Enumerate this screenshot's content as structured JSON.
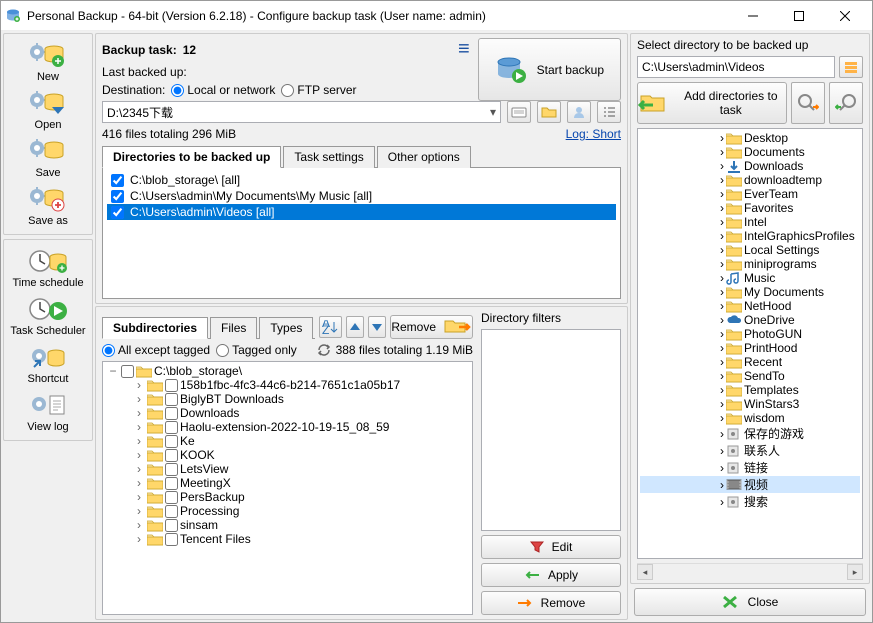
{
  "title": "Personal Backup - 64-bit (Version 6.2.18) - Configure backup task (User name: admin)",
  "sidebar": {
    "g1": [
      {
        "name": "new",
        "label": "New",
        "badge": "plus"
      },
      {
        "name": "open",
        "label": "Open",
        "badge": "down"
      },
      {
        "name": "save",
        "label": "Save",
        "badge": null
      },
      {
        "name": "saveas",
        "label": "Save as",
        "badge": "plus-red"
      }
    ],
    "g2": [
      {
        "name": "timeschedule",
        "label": "Time schedule"
      },
      {
        "name": "taskscheduler",
        "label": "Task Scheduler"
      },
      {
        "name": "shortcut",
        "label": "Shortcut"
      },
      {
        "name": "viewlog",
        "label": "View log"
      }
    ]
  },
  "task": {
    "title_label": "Backup task:",
    "title_value": "12",
    "last_label": "Last backed up:",
    "dest_label": "Destination:",
    "radio_local": "Local or network",
    "radio_ftp": "FTP server",
    "dest_path": "D:\\2345下载",
    "stats": "416 files totaling 296 MiB",
    "log_link": "Log: Short",
    "start_label": "Start backup"
  },
  "tabs": {
    "t1": "Directories to be backed up",
    "t2": "Task settings",
    "t3": "Other options"
  },
  "dirs": [
    {
      "path": "C:\\blob_storage\\ [all]",
      "sel": false
    },
    {
      "path": "C:\\Users\\admin\\My Documents\\My Music [all]",
      "sel": false
    },
    {
      "path": "C:\\Users\\admin\\Videos [all]",
      "sel": true
    }
  ],
  "midbar": {
    "remove": "Remove"
  },
  "subtabs": {
    "t1": "Subdirectories",
    "t2": "Files",
    "t3": "Types"
  },
  "subopts": {
    "all_except": "All except tagged",
    "tagged_only": "Tagged only",
    "stats": "388 files totaling 1.19 MiB"
  },
  "subtree": {
    "root": "C:\\blob_storage\\",
    "items": [
      "158b1fbc-4fc3-44c6-b214-7651c1a05b17",
      "BiglyBT Downloads",
      "Downloads",
      "Haolu-extension-2022-10-19-15_08_59",
      "Ke",
      "KOOK",
      "LetsView",
      "MeetingX",
      "PersBackup",
      "Processing",
      "sinsam",
      "Tencent Files"
    ]
  },
  "filter": {
    "title": "Directory filters",
    "edit": "Edit",
    "apply": "Apply",
    "remove": "Remove"
  },
  "right": {
    "title": "Select directory to be backed up",
    "path": "C:\\Users\\admin\\Videos",
    "add_label": "Add directories to task",
    "items": [
      {
        "name": "Desktop",
        "icon": "folder"
      },
      {
        "name": "Documents",
        "icon": "folder"
      },
      {
        "name": "Downloads",
        "icon": "download"
      },
      {
        "name": "downloadtemp",
        "icon": "folder"
      },
      {
        "name": "EverTeam",
        "icon": "folder"
      },
      {
        "name": "Favorites",
        "icon": "folder"
      },
      {
        "name": "Intel",
        "icon": "folder"
      },
      {
        "name": "IntelGraphicsProfiles",
        "icon": "folder"
      },
      {
        "name": "Local Settings",
        "icon": "folder"
      },
      {
        "name": "miniprograms",
        "icon": "folder"
      },
      {
        "name": "Music",
        "icon": "music"
      },
      {
        "name": "My Documents",
        "icon": "folder"
      },
      {
        "name": "NetHood",
        "icon": "folder"
      },
      {
        "name": "OneDrive",
        "icon": "onedrive"
      },
      {
        "name": "PhotoGUN",
        "icon": "folder"
      },
      {
        "name": "PrintHood",
        "icon": "folder"
      },
      {
        "name": "Recent",
        "icon": "folder"
      },
      {
        "name": "SendTo",
        "icon": "folder"
      },
      {
        "name": "Templates",
        "icon": "folder"
      },
      {
        "name": "WinStars3",
        "icon": "folder"
      },
      {
        "name": "wisdom",
        "icon": "folder"
      },
      {
        "name": "保存的游戏",
        "icon": "sys"
      },
      {
        "name": "联系人",
        "icon": "sys"
      },
      {
        "name": "链接",
        "icon": "sys"
      },
      {
        "name": "视频",
        "icon": "video",
        "sel": true
      },
      {
        "name": "搜索",
        "icon": "sys"
      }
    ]
  },
  "close": "Close"
}
